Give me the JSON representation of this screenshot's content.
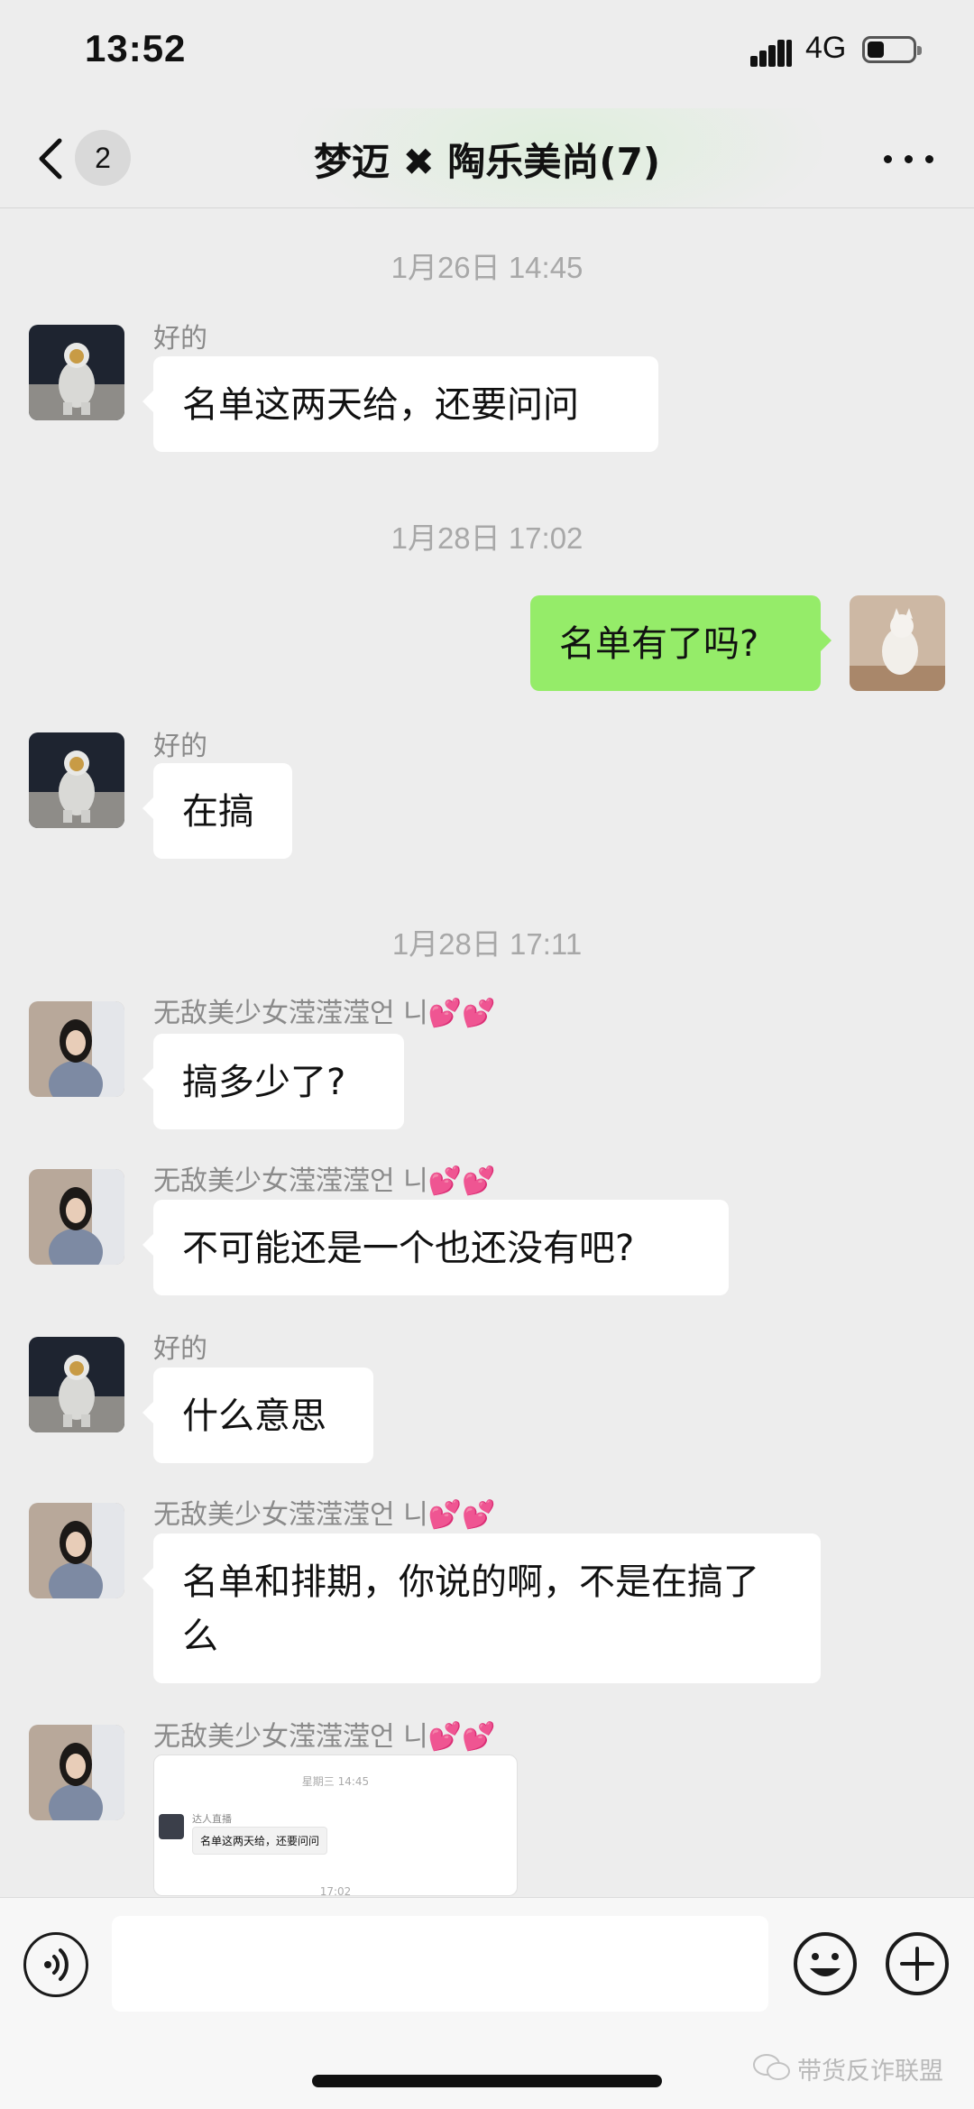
{
  "status_bar": {
    "time": "13:52",
    "network": "4G",
    "battery_level": 0.3
  },
  "header": {
    "back_badge": "2",
    "title": "梦迈 ✖ 陶乐美尚(7)",
    "more_icon": "more-dots-icon"
  },
  "timestamps": [
    "1月26日 14:45",
    "1月28日 17:02",
    "1月28日 17:11"
  ],
  "senders": {
    "haode": "好的",
    "wudi": "无敌美少女滢滢滢언 니"
  },
  "messages": [
    {
      "sender": "好的",
      "text": "名单这两天给，还要问问"
    },
    {
      "sender": "me",
      "text": "名单有了吗?"
    },
    {
      "sender": "好的",
      "text": "在搞"
    },
    {
      "sender": "无敌美少女滢滢滢언 니",
      "text": "搞多少了?"
    },
    {
      "sender": "无敌美少女滢滢滢언 니",
      "text": "不可能还是一个也还没有吧?"
    },
    {
      "sender": "好的",
      "text": "什么意思"
    },
    {
      "sender": "无敌美少女滢滢滢언 니",
      "text": "名单和排期，你说的啊，不是在搞了么"
    }
  ],
  "image_message": {
    "timestamp": "星期三 14:45",
    "sender": "达人直播",
    "text": "名单这两天给，还要问问",
    "timestamp2": "17:02"
  },
  "input_bar": {
    "voice_icon": "voice-icon",
    "emoji_icon": "emoji-icon",
    "plus_icon": "plus-icon"
  },
  "watermark": "带货反诈联盟",
  "colors": {
    "bubble_self": "#95ec69",
    "bubble_other": "#ffffff",
    "background": "#ededed"
  }
}
